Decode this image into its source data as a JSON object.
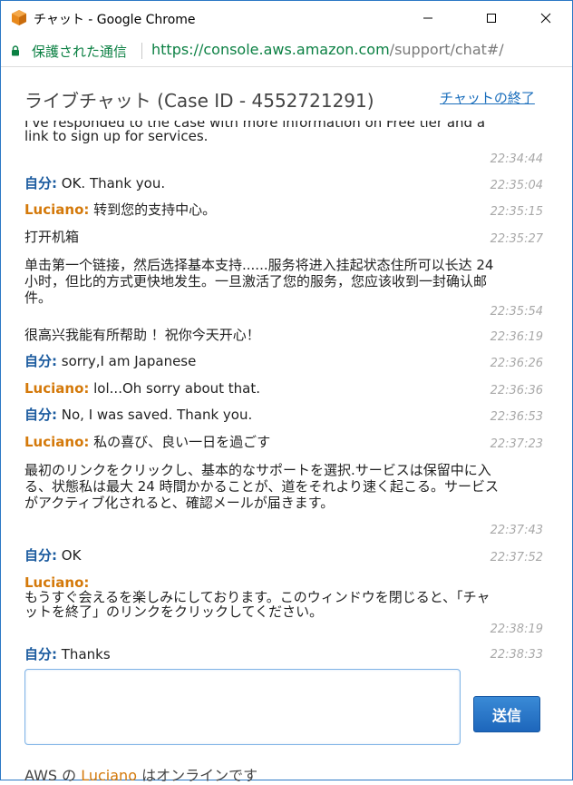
{
  "window": {
    "title": "チャット - Google Chrome",
    "accent": "#2b78c5"
  },
  "address": {
    "secure_label": "保護された通信",
    "url_host": "https://console.aws.amazon.com",
    "url_path": "/support/chat#/"
  },
  "chat": {
    "header": "ライブチャット (Case ID - 4552721291)",
    "end_link": "チャットの終了",
    "messages": [
      {
        "sender": "",
        "text": "I've responded to the case with more information on Free tier and a link to sign up for services.",
        "time": "22:34:44"
      },
      {
        "sender": "自分:",
        "text": " OK. Thank you.",
        "time": "22:35:04"
      },
      {
        "sender": "Luciano:",
        "text": " 转到您的支持中心。",
        "time": "22:35:15"
      },
      {
        "sender": "",
        "text": "打开机箱",
        "time": "22:35:27"
      },
      {
        "sender": "",
        "text": "单击第一个链接，然后选择基本支持......服务将进入挂起状态住所可以长达 24 小时，但比的方式更快地发生。一旦激活了您的服务，您应该收到一封确认邮件。",
        "time": "22:35:54"
      },
      {
        "sender": "",
        "text": "很高兴我能有所帮助 ！祝你今天开心！",
        "time": "22:36:19"
      },
      {
        "sender": "自分:",
        "text": " sorry,I am Japanese",
        "time": "22:36:26"
      },
      {
        "sender": "Luciano:",
        "text": " lol...Oh sorry about that.",
        "time": "22:36:36"
      },
      {
        "sender": "自分:",
        "text": " No, I was saved. Thank you.",
        "time": "22:36:53"
      },
      {
        "sender": "Luciano:",
        "text": " 私の喜び、良い一日を過ごす",
        "time": "22:37:23"
      },
      {
        "sender": "",
        "text": "最初のリンクをクリックし、基本的なサポートを選択.サービスは保留中に入る、状態私は最大 24 時間かかることが、道をそれより速く起こる。サービスがアクティブ化されると、確認メールが届きます。",
        "time": "22:37:43"
      },
      {
        "sender": "自分:",
        "text": " OK",
        "time": "22:37:52"
      },
      {
        "sender": "Luciano:",
        "text": "もうすぐ会えるを楽しみにしております。このウィンドウを閉じると、「チャットを終了」のリンクをクリックしてください。",
        "time": "22:38:19"
      },
      {
        "sender": "自分:",
        "text": " Thanks",
        "time": "22:38:33"
      }
    ]
  },
  "composer": {
    "value": "",
    "send_label": "送信"
  },
  "status": {
    "prefix": "AWS の ",
    "agent": "Luciano",
    "suffix": " はオンラインです"
  },
  "colors": {
    "self": "#1a5a9e",
    "agent": "#d4790a",
    "link": "#1a6ebc",
    "secure": "#0b8043"
  },
  "icons": {
    "app": "aws-cube-icon",
    "lock": "lock-icon",
    "minimize": "minimize-icon",
    "maximize": "maximize-icon",
    "close": "close-icon"
  }
}
